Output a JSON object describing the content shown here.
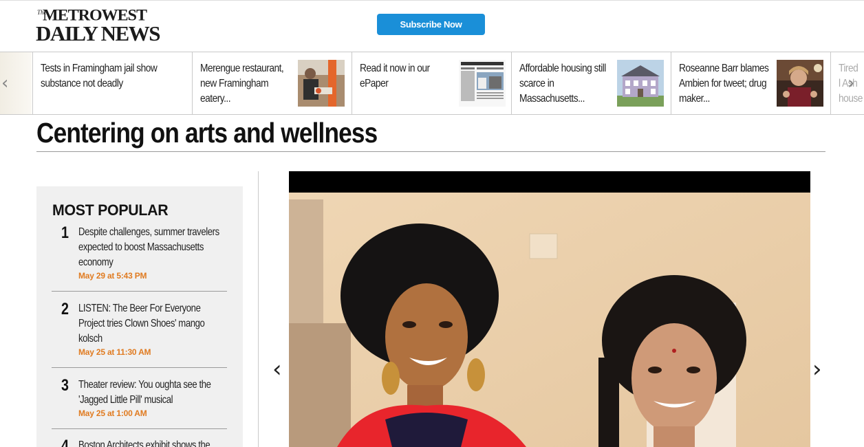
{
  "header": {
    "logo_small": "The",
    "logo_line1": "METROWEST",
    "logo_line2": "DAILY NEWS",
    "subscribe_label": "Subscribe Now"
  },
  "carousel": {
    "items": [
      {
        "text": "Tests in Framingham jail show substance not deadly"
      },
      {
        "text": "Merengue restaurant, new Framingham eatery..."
      },
      {
        "text": "Read it now in our ePaper"
      },
      {
        "text": "Affordable housing still scarce in Massachusetts..."
      },
      {
        "text": "Roseanne Barr blames Ambien for tweet; drug maker..."
      },
      {
        "text": "Tired l Ash house"
      }
    ],
    "prev_icon": "chevron-left-icon",
    "next_icon": "chevron-right-icon"
  },
  "page": {
    "title": "Centering on arts and wellness"
  },
  "most_popular": {
    "heading": "MOST POPULAR",
    "items": [
      {
        "num": "1",
        "title": "Despite challenges, summer travelers expected to boost Massachusetts economy",
        "date": "May 29 at 5:43 PM"
      },
      {
        "num": "2",
        "title": "LISTEN: The Beer For Everyone Project tries Clown Shoes' mango kolsch",
        "date": "May 25 at 11:30 AM"
      },
      {
        "num": "3",
        "title": "Theater review: You oughta see the 'Jagged Little Pill' musical",
        "date": "May 25 at 1:00 AM"
      },
      {
        "num": "4",
        "title": "Boston Architects exhibit shows the",
        "date": ""
      }
    ]
  },
  "gallery": {
    "prev_icon": "chevron-left-icon",
    "next_icon": "chevron-right-icon"
  },
  "colors": {
    "accent": "#1a8fd8",
    "date_orange": "#e07b21",
    "sidebar_bg": "#f0f0f0"
  }
}
